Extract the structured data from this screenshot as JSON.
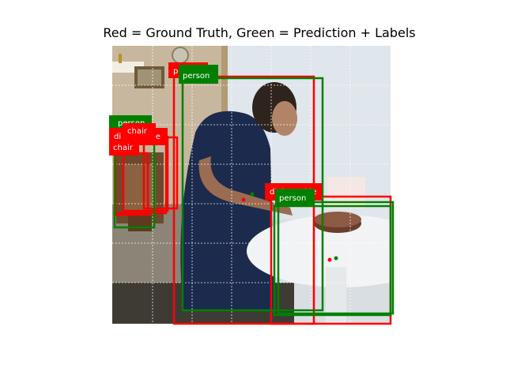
{
  "title": "Red = Ground Truth, Green = Prediction + Labels",
  "colors": {
    "ground_truth": "#ff0000",
    "prediction": "#008000",
    "grid": "#ffffff"
  },
  "labels": {
    "gt_person": "pe",
    "pred_person_main": "person",
    "pred_person_left": "person",
    "gt_chair_top": "chair",
    "gt_dining_left": "di",
    "gt_dining_left_tail": "le",
    "gt_chair_left": "chair",
    "gt_dining_right": "dining table",
    "pred_person_right": "person"
  }
}
